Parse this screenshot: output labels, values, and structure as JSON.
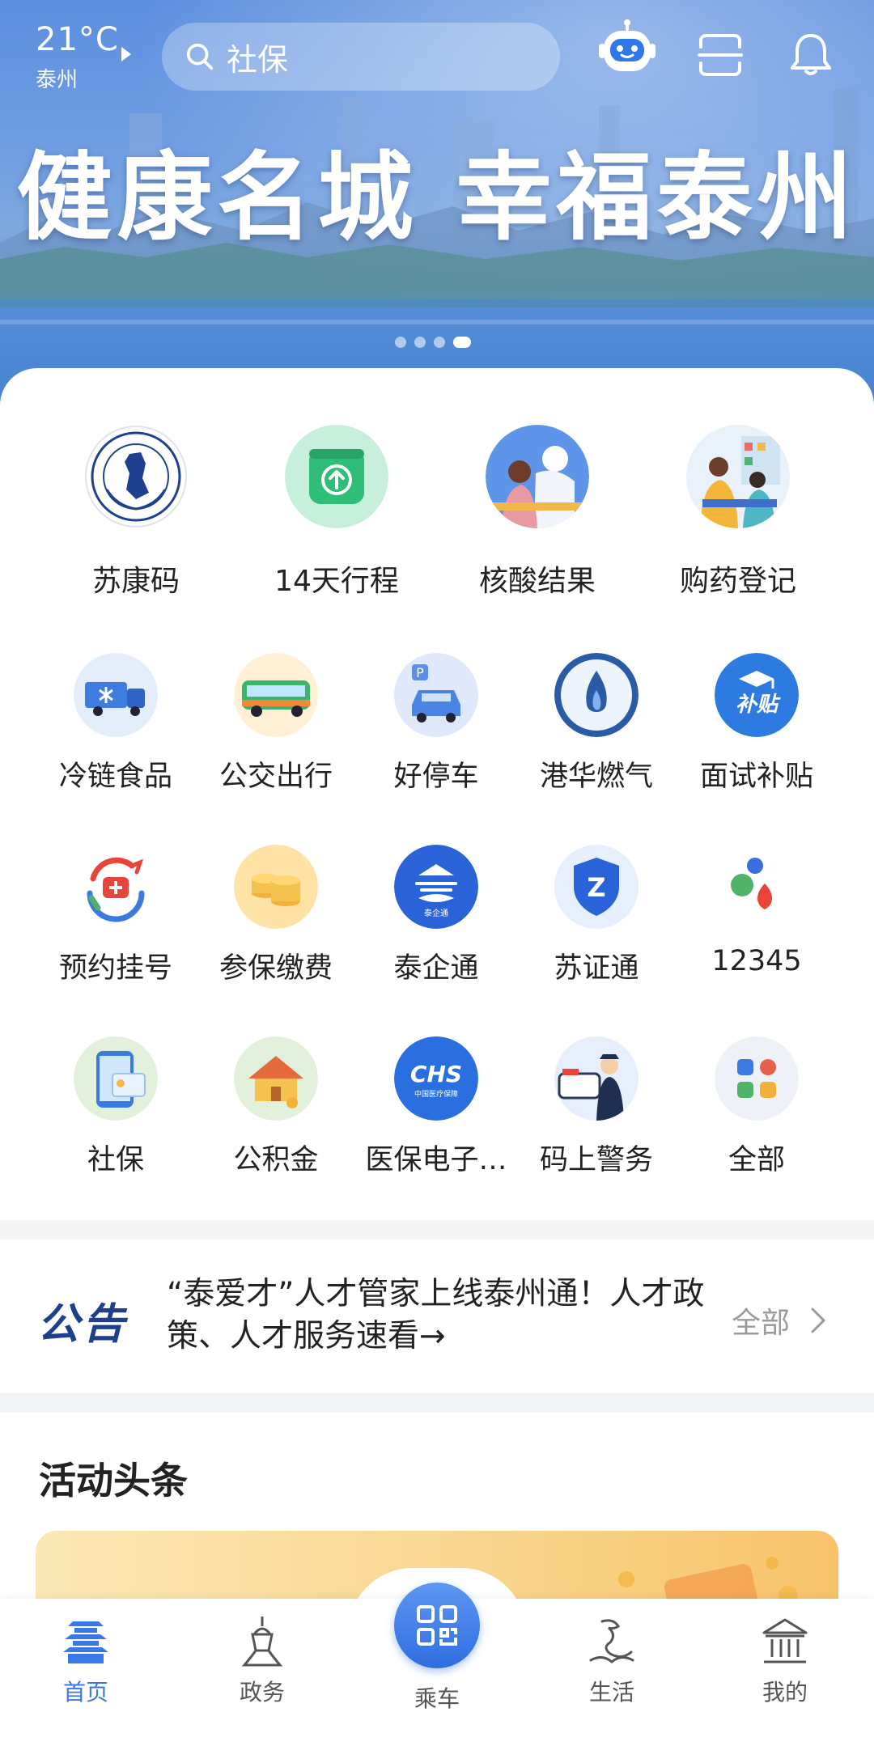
{
  "header": {
    "temperature": "21°C",
    "city": "泰州",
    "search_placeholder": "社保",
    "slogan": "健康名城 幸福泰州",
    "carousel_total": 4,
    "carousel_active": 4
  },
  "featured_services": [
    {
      "label": "苏康码",
      "icon": "health-code-emblem-icon"
    },
    {
      "label": "14天行程",
      "icon": "travel-record-icon"
    },
    {
      "label": "核酸结果",
      "icon": "nucleic-test-icon"
    },
    {
      "label": "购药登记",
      "icon": "medicine-registration-icon"
    }
  ],
  "services": [
    {
      "label": "冷链食品",
      "icon": "cold-chain-truck-icon"
    },
    {
      "label": "公交出行",
      "icon": "bus-icon"
    },
    {
      "label": "好停车",
      "icon": "parking-car-icon"
    },
    {
      "label": "港华燃气",
      "icon": "gas-flame-icon"
    },
    {
      "label": "面试补贴",
      "icon": "interview-subsidy-icon"
    },
    {
      "label": "预约挂号",
      "icon": "hospital-appointment-icon"
    },
    {
      "label": "参保缴费",
      "icon": "coins-icon"
    },
    {
      "label": "泰企通",
      "icon": "taiqitong-icon"
    },
    {
      "label": "苏证通",
      "icon": "suzhengtong-icon"
    },
    {
      "label": "12345",
      "icon": "hotline-12345-icon"
    },
    {
      "label": "社保",
      "icon": "social-security-card-icon"
    },
    {
      "label": "公积金",
      "icon": "housing-fund-house-icon"
    },
    {
      "label": "医保电子…",
      "icon": "chs-medical-insurance-icon"
    },
    {
      "label": "码上警务",
      "icon": "police-icon"
    },
    {
      "label": "全部",
      "icon": "all-apps-grid-icon"
    }
  ],
  "notice": {
    "tag": "公告",
    "text": "“泰爱才”人才管家上线泰州通！人才政策、人才服务速看→",
    "all_label": "全部"
  },
  "activity": {
    "title": "活动头条"
  },
  "bottom_nav": [
    {
      "label": "首页",
      "icon": "home-tower-icon",
      "active": true
    },
    {
      "label": "政务",
      "icon": "government-tower-icon",
      "active": false
    },
    {
      "label": "乘车",
      "icon": "ride-qr-icon",
      "active": false
    },
    {
      "label": "生活",
      "icon": "dragon-icon",
      "active": false
    },
    {
      "label": "我的",
      "icon": "museum-icon",
      "active": false
    }
  ],
  "colors": {
    "primary": "#3b78e7",
    "notice_tag": "#1d3f8c",
    "banner_blue": "#5d8fdf"
  }
}
